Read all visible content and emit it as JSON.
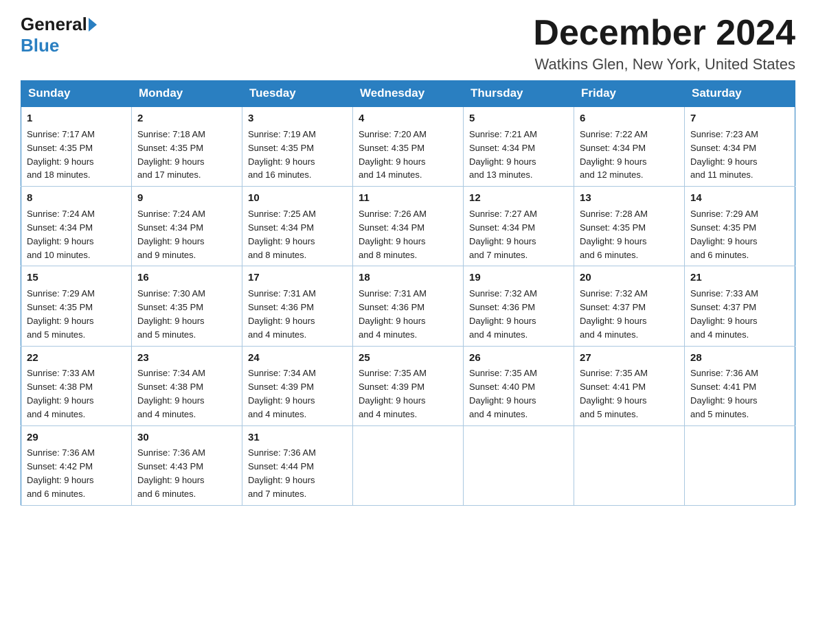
{
  "header": {
    "logo_general": "General",
    "logo_blue": "Blue",
    "month_title": "December 2024",
    "location": "Watkins Glen, New York, United States"
  },
  "days_of_week": [
    "Sunday",
    "Monday",
    "Tuesday",
    "Wednesday",
    "Thursday",
    "Friday",
    "Saturday"
  ],
  "weeks": [
    [
      {
        "day": "1",
        "sunrise": "7:17 AM",
        "sunset": "4:35 PM",
        "daylight": "9 hours and 18 minutes."
      },
      {
        "day": "2",
        "sunrise": "7:18 AM",
        "sunset": "4:35 PM",
        "daylight": "9 hours and 17 minutes."
      },
      {
        "day": "3",
        "sunrise": "7:19 AM",
        "sunset": "4:35 PM",
        "daylight": "9 hours and 16 minutes."
      },
      {
        "day": "4",
        "sunrise": "7:20 AM",
        "sunset": "4:35 PM",
        "daylight": "9 hours and 14 minutes."
      },
      {
        "day": "5",
        "sunrise": "7:21 AM",
        "sunset": "4:34 PM",
        "daylight": "9 hours and 13 minutes."
      },
      {
        "day": "6",
        "sunrise": "7:22 AM",
        "sunset": "4:34 PM",
        "daylight": "9 hours and 12 minutes."
      },
      {
        "day": "7",
        "sunrise": "7:23 AM",
        "sunset": "4:34 PM",
        "daylight": "9 hours and 11 minutes."
      }
    ],
    [
      {
        "day": "8",
        "sunrise": "7:24 AM",
        "sunset": "4:34 PM",
        "daylight": "9 hours and 10 minutes."
      },
      {
        "day": "9",
        "sunrise": "7:24 AM",
        "sunset": "4:34 PM",
        "daylight": "9 hours and 9 minutes."
      },
      {
        "day": "10",
        "sunrise": "7:25 AM",
        "sunset": "4:34 PM",
        "daylight": "9 hours and 8 minutes."
      },
      {
        "day": "11",
        "sunrise": "7:26 AM",
        "sunset": "4:34 PM",
        "daylight": "9 hours and 8 minutes."
      },
      {
        "day": "12",
        "sunrise": "7:27 AM",
        "sunset": "4:34 PM",
        "daylight": "9 hours and 7 minutes."
      },
      {
        "day": "13",
        "sunrise": "7:28 AM",
        "sunset": "4:35 PM",
        "daylight": "9 hours and 6 minutes."
      },
      {
        "day": "14",
        "sunrise": "7:29 AM",
        "sunset": "4:35 PM",
        "daylight": "9 hours and 6 minutes."
      }
    ],
    [
      {
        "day": "15",
        "sunrise": "7:29 AM",
        "sunset": "4:35 PM",
        "daylight": "9 hours and 5 minutes."
      },
      {
        "day": "16",
        "sunrise": "7:30 AM",
        "sunset": "4:35 PM",
        "daylight": "9 hours and 5 minutes."
      },
      {
        "day": "17",
        "sunrise": "7:31 AM",
        "sunset": "4:36 PM",
        "daylight": "9 hours and 4 minutes."
      },
      {
        "day": "18",
        "sunrise": "7:31 AM",
        "sunset": "4:36 PM",
        "daylight": "9 hours and 4 minutes."
      },
      {
        "day": "19",
        "sunrise": "7:32 AM",
        "sunset": "4:36 PM",
        "daylight": "9 hours and 4 minutes."
      },
      {
        "day": "20",
        "sunrise": "7:32 AM",
        "sunset": "4:37 PM",
        "daylight": "9 hours and 4 minutes."
      },
      {
        "day": "21",
        "sunrise": "7:33 AM",
        "sunset": "4:37 PM",
        "daylight": "9 hours and 4 minutes."
      }
    ],
    [
      {
        "day": "22",
        "sunrise": "7:33 AM",
        "sunset": "4:38 PM",
        "daylight": "9 hours and 4 minutes."
      },
      {
        "day": "23",
        "sunrise": "7:34 AM",
        "sunset": "4:38 PM",
        "daylight": "9 hours and 4 minutes."
      },
      {
        "day": "24",
        "sunrise": "7:34 AM",
        "sunset": "4:39 PM",
        "daylight": "9 hours and 4 minutes."
      },
      {
        "day": "25",
        "sunrise": "7:35 AM",
        "sunset": "4:39 PM",
        "daylight": "9 hours and 4 minutes."
      },
      {
        "day": "26",
        "sunrise": "7:35 AM",
        "sunset": "4:40 PM",
        "daylight": "9 hours and 4 minutes."
      },
      {
        "day": "27",
        "sunrise": "7:35 AM",
        "sunset": "4:41 PM",
        "daylight": "9 hours and 5 minutes."
      },
      {
        "day": "28",
        "sunrise": "7:36 AM",
        "sunset": "4:41 PM",
        "daylight": "9 hours and 5 minutes."
      }
    ],
    [
      {
        "day": "29",
        "sunrise": "7:36 AM",
        "sunset": "4:42 PM",
        "daylight": "9 hours and 6 minutes."
      },
      {
        "day": "30",
        "sunrise": "7:36 AM",
        "sunset": "4:43 PM",
        "daylight": "9 hours and 6 minutes."
      },
      {
        "day": "31",
        "sunrise": "7:36 AM",
        "sunset": "4:44 PM",
        "daylight": "9 hours and 7 minutes."
      },
      null,
      null,
      null,
      null
    ]
  ],
  "labels": {
    "sunrise": "Sunrise: ",
    "sunset": "Sunset: ",
    "daylight": "Daylight: "
  },
  "colors": {
    "header_bg": "#2a7fc1",
    "header_text": "#ffffff",
    "border": "#aac8e0"
  }
}
